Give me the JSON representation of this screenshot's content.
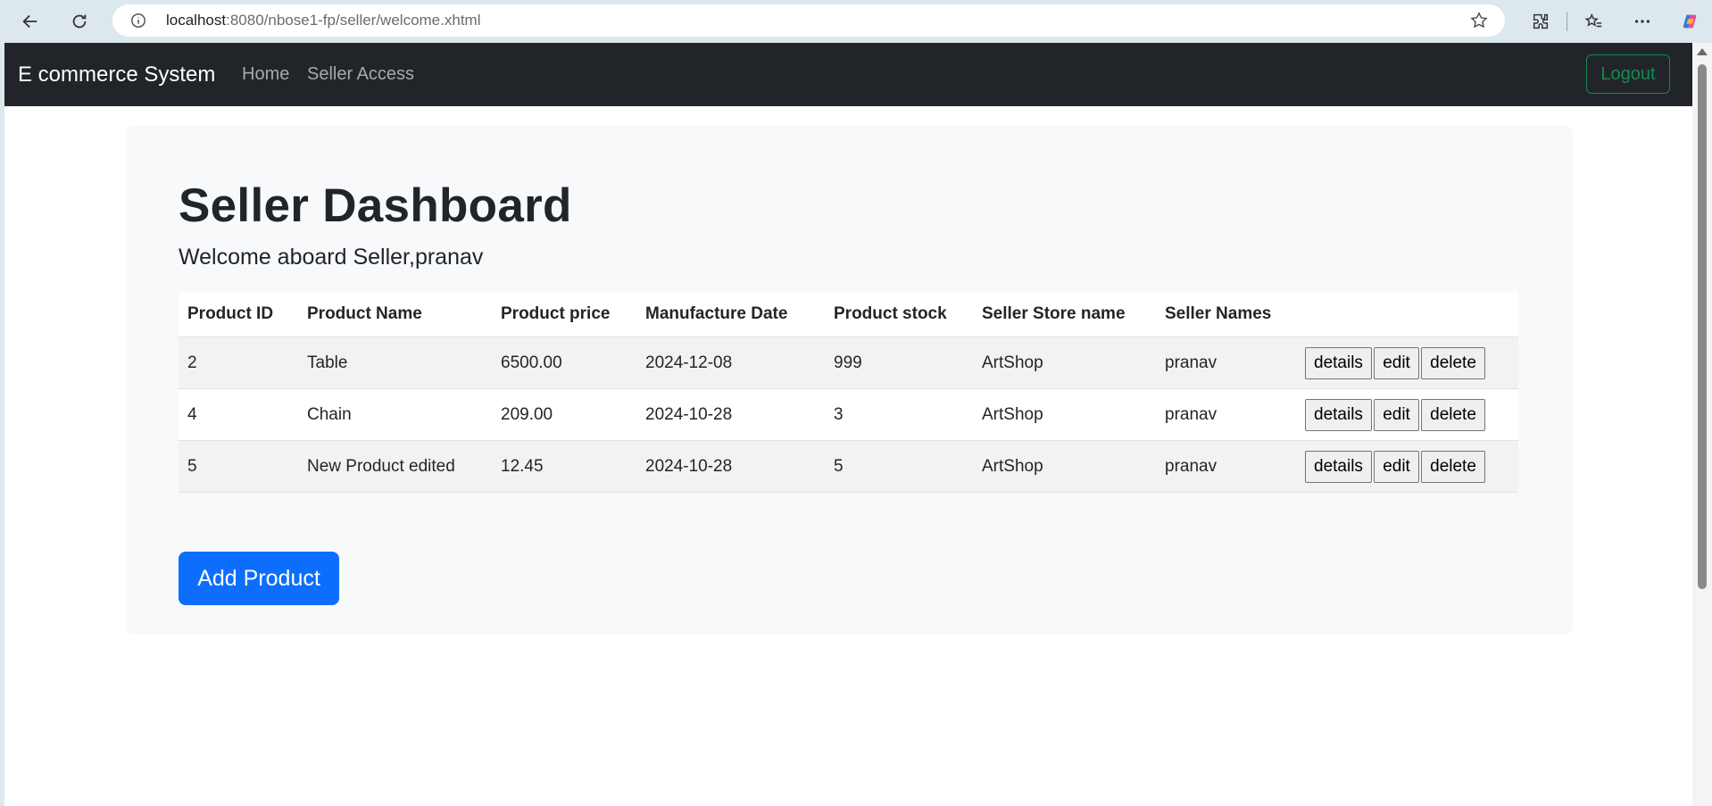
{
  "browser": {
    "url_host": "localhost",
    "url_path": ":8080/nbose1-fp/seller/welcome.xhtml"
  },
  "navbar": {
    "brand": "E commerce System",
    "links": [
      "Home",
      "Seller Access"
    ],
    "logout_label": "Logout"
  },
  "main": {
    "title": "Seller Dashboard",
    "welcome": "Welcome aboard Seller,pranav",
    "table": {
      "headers": [
        "Product ID",
        "Product Name",
        "Product price",
        "Manufacture Date",
        "Product stock",
        "Seller Store name",
        "Seller Names",
        ""
      ],
      "rows": [
        [
          "2",
          "Table",
          "6500.00",
          "2024-12-08",
          "999",
          "ArtShop",
          "pranav"
        ],
        [
          "4",
          "Chain",
          "209.00",
          "2024-10-28",
          "3",
          "ArtShop",
          "pranav"
        ],
        [
          "5",
          "New Product edited",
          "12.45",
          "2024-10-28",
          "5",
          "ArtShop",
          "pranav"
        ]
      ],
      "actions": [
        "details",
        "edit",
        "delete"
      ]
    },
    "add_product_label": "Add Product"
  },
  "colors": {
    "navbar_bg": "#212529",
    "logout_accent": "#198754",
    "primary": "#0d6efd",
    "jumbotron_bg": "#f8f9fa"
  }
}
